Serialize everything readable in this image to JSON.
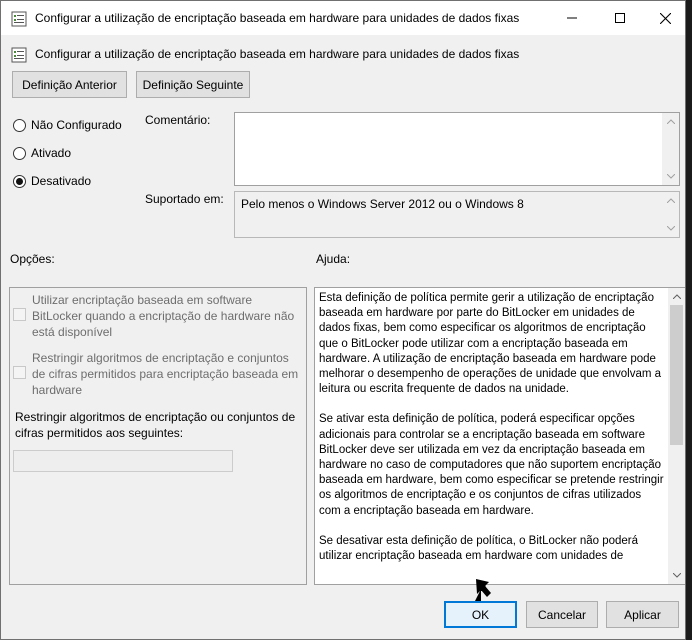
{
  "window": {
    "title": "Configurar a utilização de encriptação baseada em hardware para unidades de dados fixas",
    "controls": {
      "minimize": "minimize-icon",
      "maximize": "maximize-icon",
      "close": "close-icon"
    }
  },
  "header": {
    "policy_name": "Configurar a utilização de encriptação baseada em hardware para unidades de dados fixas"
  },
  "nav": {
    "previous": "Definição Anterior",
    "next": "Definição Seguinte"
  },
  "state": {
    "options": [
      {
        "label": "Não Configurado",
        "selected": false
      },
      {
        "label": "Ativado",
        "selected": false
      },
      {
        "label": "Desativado",
        "selected": true
      }
    ]
  },
  "comment": {
    "label": "Comentário:",
    "value": ""
  },
  "supported": {
    "label": "Suportado em:",
    "value": "Pelo menos o Windows Server 2012 ou o Windows 8"
  },
  "options_panel": {
    "label": "Opções:",
    "checkbox1": "Utilizar encriptação baseada em software BitLocker quando a encriptação de hardware não está disponível",
    "checkbox2": "Restringir algoritmos de encriptação e conjuntos de cifras permitidos para encriptação baseada em hardware",
    "restrict_label": "Restringir algoritmos de encriptação ou conjuntos de cifras permitidos aos seguintes:",
    "restrict_value": ""
  },
  "help": {
    "label": "Ajuda:",
    "paragraphs": [
      "Esta definição de política permite gerir a utilização de encriptação baseada em hardware por parte do BitLocker em unidades de dados fixas, bem como especificar os algoritmos de encriptação que o BitLocker pode utilizar com a encriptação baseada em hardware. A utilização de encriptação baseada em hardware pode melhorar o desempenho de operações de unidade que envolvam a leitura ou escrita frequente de dados na unidade.",
      "Se ativar esta definição de política, poderá especificar opções adicionais para controlar se a encriptação baseada em software BitLocker deve ser utilizada em vez da encriptação baseada em hardware no caso de computadores que não suportem encriptação baseada em hardware, bem como especificar se pretende restringir os algoritmos de encriptação e os conjuntos de cifras utilizados com a encriptação baseada em hardware.",
      "Se desativar esta definição de política, o BitLocker não poderá utilizar encriptação baseada em hardware com unidades de"
    ]
  },
  "footer": {
    "ok": "OK",
    "cancel": "Cancelar",
    "apply": "Aplicar"
  }
}
